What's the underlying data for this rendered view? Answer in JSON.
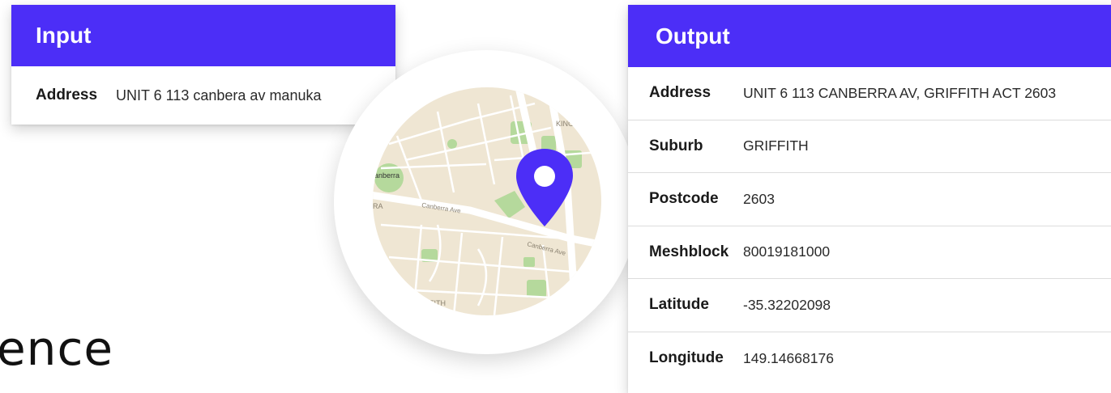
{
  "input": {
    "title": "Input",
    "address_label": "Address",
    "address_value": "UNIT 6 113 canbera av manuka"
  },
  "output": {
    "title": "Output",
    "rows": [
      {
        "label": "Address",
        "value": "UNIT 6 113 CANBERRA AV, GRIFFITH ACT 2603"
      },
      {
        "label": "Suburb",
        "value": "GRIFFITH"
      },
      {
        "label": "Postcode",
        "value": "2603"
      },
      {
        "label": "Meshblock",
        "value": "80019181000"
      },
      {
        "label": "Latitude",
        "value": "-35.32202098"
      },
      {
        "label": "Longitude",
        "value": "149.14668176"
      }
    ]
  },
  "map": {
    "labels": {
      "kingston": "KINGSTON",
      "canberra": "anberra",
      "canberra_ave": "Canberra Ave",
      "canberra_ave_2": "Canberra Ave",
      "griffith": "IFFITH",
      "ra": "RA"
    },
    "colors": {
      "land": "#efe6d3",
      "park": "#b5d99c",
      "road": "#ffffff",
      "pin": "#4c2ef7"
    },
    "pin_icon": "map-pin-icon"
  },
  "partial_text": "ence"
}
